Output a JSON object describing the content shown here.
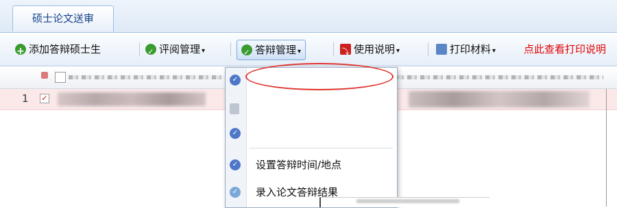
{
  "tab": {
    "label": "硕士论文送审"
  },
  "toolbar": {
    "add_label": "添加答辩硕士生",
    "review_label": "评阅管理",
    "defense_label": "答辩管理",
    "manual_label": "使用说明",
    "print_label": "打印材料",
    "notice_label": "点此查看打印说明"
  },
  "grid": {
    "row_number": "1"
  },
  "menu": {
    "items": [
      {
        "label": "设置答辩时间/地点",
        "icon": "check-circle-icon"
      },
      {
        "label": "录入论文答辩结果",
        "icon": "edit-icon"
      }
    ]
  },
  "colors": {
    "accent": "#15428b",
    "notice": "#e00000",
    "highlight_ellipse": "#e0322c",
    "row_selected": "#fbe9ea"
  }
}
